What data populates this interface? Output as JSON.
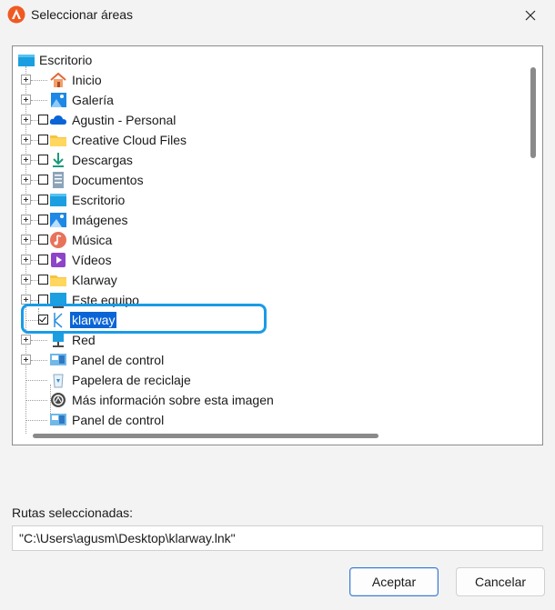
{
  "window": {
    "title": "Seleccionar áreas",
    "close_label": "×"
  },
  "tree": {
    "root": "Escritorio",
    "items": [
      {
        "label": "Inicio",
        "icon": "home-icon"
      },
      {
        "label": "Galería",
        "icon": "gallery-icon"
      },
      {
        "label": "Agustin - Personal",
        "icon": "onedrive-cloud-icon"
      },
      {
        "label": "Creative Cloud Files",
        "icon": "folder-icon"
      },
      {
        "label": "Descargas",
        "icon": "download-icon"
      },
      {
        "label": "Documentos",
        "icon": "documents-icon"
      },
      {
        "label": "Escritorio",
        "icon": "desktop-icon"
      },
      {
        "label": "Imágenes",
        "icon": "pictures-icon"
      },
      {
        "label": "Música",
        "icon": "music-icon"
      },
      {
        "label": "Vídeos",
        "icon": "videos-icon"
      },
      {
        "label": "Klarway",
        "icon": "folder-icon"
      },
      {
        "label": "Este equipo",
        "icon": "computer-icon"
      },
      {
        "label": "klarway",
        "icon": "klarway-icon",
        "checked": true,
        "selected": true
      },
      {
        "label": "Red",
        "icon": "network-icon"
      },
      {
        "label": "Panel de control",
        "icon": "control-panel-icon"
      },
      {
        "label": "Papelera de reciclaje",
        "icon": "recycle-bin-icon"
      },
      {
        "label": "Más información sobre esta imagen",
        "icon": "info-circle-icon"
      },
      {
        "label": "Panel de control",
        "icon": "control-panel-icon"
      }
    ]
  },
  "paths": {
    "label": "Rutas seleccionadas:",
    "value": "\"C:\\Users\\agusm\\Desktop\\klarway.lnk\""
  },
  "buttons": {
    "accept": "Aceptar",
    "cancel": "Cancelar"
  }
}
